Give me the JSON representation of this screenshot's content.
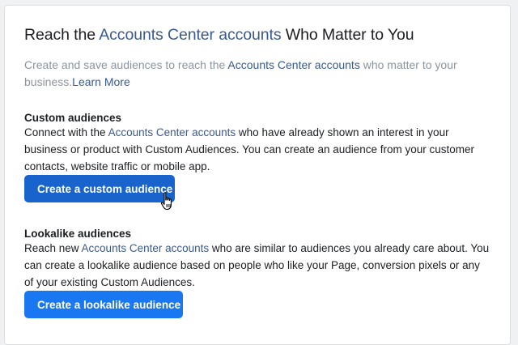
{
  "header": {
    "title_before": "Reach the ",
    "title_link": "Accounts Center accounts",
    "title_after": " Who Matter to You"
  },
  "intro": {
    "text_before": "Create and save audiences to reach the ",
    "link": "Accounts Center accounts",
    "text_after": " who matter to your business.",
    "learn_more": "Learn More"
  },
  "custom": {
    "title": "Custom audiences",
    "text_before": "Connect with the ",
    "link": "Accounts Center accounts",
    "text_after": " who have already shown an interest in your business or product with Custom Audiences. You can create an audience from your customer contacts, website traffic or mobile app.",
    "button": "Create a custom audience"
  },
  "lookalike": {
    "title": "Lookalike audiences",
    "text_before": "Reach new ",
    "link": "Accounts Center accounts",
    "text_after": " who are similar to audiences you already care about. You can create a lookalike audience based on people who like your Page, conversion pixels or any of your existing Custom Audiences.",
    "button": "Create a lookalike audience"
  },
  "colors": {
    "link": "#3a5a8f",
    "primary_button_hover": "#1864cc",
    "primary_button": "#1a77f2",
    "muted_text": "#8d949e"
  },
  "icons": {
    "cursor": "hand-pointer-cursor-icon"
  }
}
